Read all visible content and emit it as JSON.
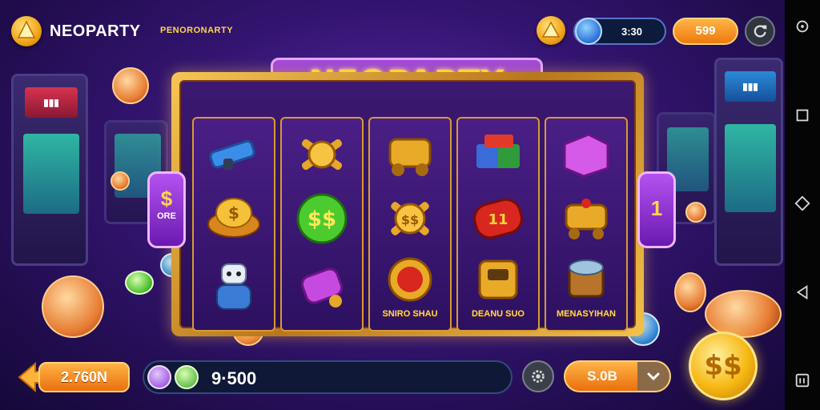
{
  "header": {
    "brand": "NEOPARTY",
    "brand_sub": "PENORONARTY",
    "level_value": "3:30",
    "coins": "599"
  },
  "game": {
    "title": "NEOPARTY",
    "left_tab": {
      "symbol": "$",
      "label": "ORE"
    },
    "right_tab": {
      "symbol": "1"
    },
    "reels": [
      {
        "symbols": [
          "blaster",
          "burger-coin",
          "robot"
        ],
        "label": ""
      },
      {
        "symbols": [
          "gear-cross",
          "green-dollar-coin",
          "purple-cannon"
        ],
        "label": ""
      },
      {
        "symbols": [
          "golden-cart",
          "gold-gear-coin",
          "red-gem-amulet"
        ],
        "label": "SNIRO SHAU"
      },
      {
        "symbols": [
          "rainbow-box",
          "red-chip",
          "golden-machine"
        ],
        "label": "DEANU SUO"
      },
      {
        "symbols": [
          "pink-crate",
          "gold-cart",
          "drum"
        ],
        "label": "MENASYIHAN"
      }
    ]
  },
  "bottom": {
    "bet": "2.760N",
    "wallet": "9·500",
    "stake": "S.0B",
    "spin_label": "$$"
  },
  "colors": {
    "accent_orange": "#ef7a0b",
    "gold": "#f6b813",
    "purple": "#6a1ab0"
  }
}
